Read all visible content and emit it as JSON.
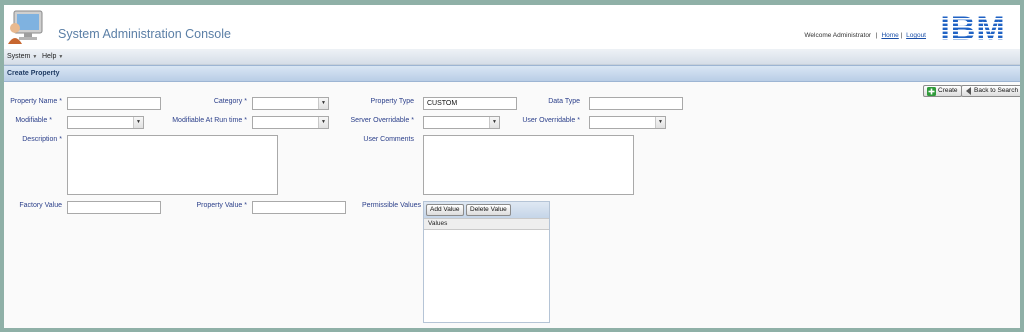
{
  "header": {
    "app_title": "System Administration Console",
    "welcome_text": "Welcome Administrator",
    "home_link": "Home",
    "logout_link": "Logout",
    "brand": "IBM"
  },
  "menu": {
    "items": [
      {
        "label": "System"
      },
      {
        "label": "Help"
      }
    ]
  },
  "section": {
    "title": "Create Property"
  },
  "actions": {
    "create_label": "Create",
    "back_label": "Back to Search"
  },
  "form": {
    "property_name": {
      "label": "Property Name",
      "required": "*",
      "value": ""
    },
    "category": {
      "label": "Category",
      "required": "*",
      "value": ""
    },
    "property_type": {
      "label": "Property Type",
      "value": "CUSTOM"
    },
    "data_type": {
      "label": "Data Type",
      "value": ""
    },
    "modifiable": {
      "label": "Modifiable",
      "required": "*",
      "value": ""
    },
    "modifiable_runtime": {
      "label": "Modifiable At Run time",
      "required": "*",
      "value": ""
    },
    "server_overridable": {
      "label": "Server Overridable",
      "required": "*",
      "value": ""
    },
    "user_overridable": {
      "label": "User Overridable",
      "required": "*",
      "value": ""
    },
    "description": {
      "label": "Description",
      "required": "*",
      "value": ""
    },
    "user_comments": {
      "label": "User Comments",
      "value": ""
    },
    "factory_value": {
      "label": "Factory Value",
      "value": ""
    },
    "property_value": {
      "label": "Property Value",
      "required": "*",
      "value": ""
    },
    "permissible_values": {
      "label": "Permissible Values",
      "add_label": "Add Value",
      "delete_label": "Delete Value",
      "column_header": "Values"
    }
  },
  "colors": {
    "frame": "#8fb0a7",
    "title": "#5b7fa6",
    "label": "#2b3f8a",
    "section_bg": "#c9d9ec",
    "brand": "#1f62c4"
  }
}
